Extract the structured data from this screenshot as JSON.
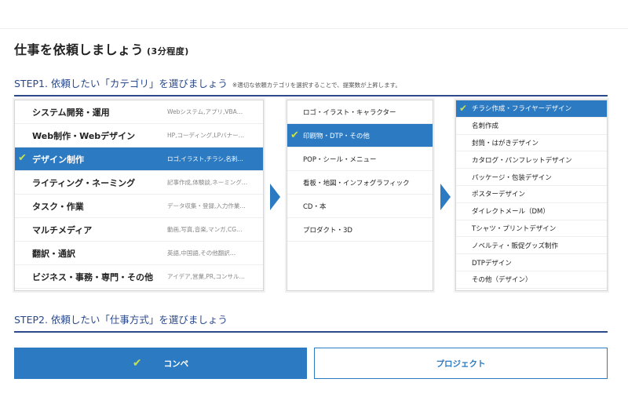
{
  "title": {
    "main": "仕事を依頼しましょう",
    "sub": "(3分程度)"
  },
  "step1": {
    "label": "STEP1. 依頼したい「カテゴリ」を選びましょう",
    "note": "※適切な依頼カテゴリを選択することで、提案数が上昇します。"
  },
  "step2": {
    "label": "STEP2. 依頼したい「仕事方式」を選びましょう"
  },
  "check_mark": "✔",
  "categories": [
    {
      "name": "システム開発・運用",
      "desc": "Webシステム,アプリ,VBA…"
    },
    {
      "name": "Web制作・Webデザイン",
      "desc": "HP,コーディング,LPバナー…"
    },
    {
      "name": "デザイン制作",
      "desc": "ロゴ,イラスト,チラシ,名刺…"
    },
    {
      "name": "ライティング・ネーミング",
      "desc": "記事作成,体験談,ネーミング…"
    },
    {
      "name": "タスク・作業",
      "desc": "データ収集・登録,入力作業…"
    },
    {
      "name": "マルチメディア",
      "desc": "動画,写真,音楽,マンガ,CG…"
    },
    {
      "name": "翻訳・通訳",
      "desc": "英語,中国語,その他翻訳…"
    },
    {
      "name": "ビジネス・事務・専門・その他",
      "desc": "アイデア,営業,PR,コンサル…"
    }
  ],
  "subcategories": [
    "ロゴ・イラスト・キャラクター",
    "印刷物・DTP・その他",
    "POP・シール・メニュー",
    "看板・地図・インフォグラフィック",
    "CD・本",
    "プロダクト・3D"
  ],
  "items": [
    "チラシ作成・フライヤーデザイン",
    "名刺作成",
    "封筒・はがきデザイン",
    "カタログ・パンフレットデザイン",
    "パッケージ・包装デザイン",
    "ポスターデザイン",
    "ダイレクトメール（DM）",
    "Tシャツ・プリントデザイン",
    "ノベルティ・販促グッズ制作",
    "DTPデザイン",
    "その他（デザイン）"
  ],
  "selected": {
    "category": "デザイン制作",
    "subcategory": "印刷物・DTP・その他",
    "item": "チラシ作成・フライヤーデザイン",
    "method": "コンペ"
  },
  "methods": {
    "compe": "コンペ",
    "project": "プロジェクト"
  },
  "colors": {
    "accent": "#2b7ac2",
    "heading": "#2b4a8c",
    "check": "#c8e04a"
  }
}
